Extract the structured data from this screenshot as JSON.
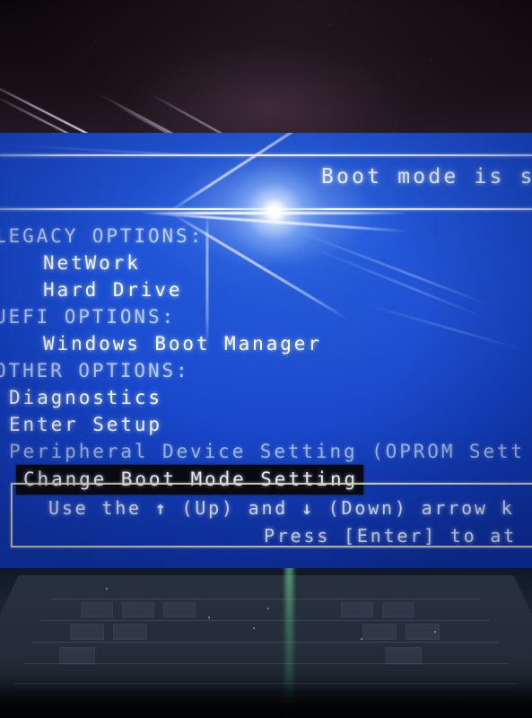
{
  "photo": {
    "subject": "bios-boot-menu-photo",
    "colors": {
      "screen_blue": "#1546cf",
      "text_white": "#ffffff",
      "text_dim": "#a9bfe6",
      "selection_background": "#0a0a10",
      "frame_border": "#eeebce",
      "keyboard_dark": "#18212f",
      "flare_white": "#ffffff",
      "green_beam": "#82ffa0"
    }
  },
  "bios": {
    "header": {
      "text": "Boot mode is s"
    },
    "menu": [
      {
        "label": "LEGACY OPTIONS:",
        "kind": "group",
        "selected": false
      },
      {
        "label": "NetWork",
        "kind": "item",
        "selected": false,
        "indent": true
      },
      {
        "label": "Hard Drive",
        "kind": "item",
        "selected": false,
        "indent": true
      },
      {
        "label": "UEFI OPTIONS:",
        "kind": "group",
        "selected": false
      },
      {
        "label": "Windows Boot Manager",
        "kind": "item",
        "selected": false,
        "indent": true
      },
      {
        "label": "OTHER OPTIONS:",
        "kind": "group",
        "selected": false
      },
      {
        "label": "Diagnostics",
        "kind": "item",
        "selected": false,
        "indent": false
      },
      {
        "label": "Enter Setup",
        "kind": "item",
        "selected": false,
        "indent": false
      },
      {
        "label": "Peripheral Device Setting (OPROM Sett",
        "kind": "disabled",
        "selected": false
      },
      {
        "label": "Change Boot Mode Setting",
        "kind": "selected",
        "selected": true
      }
    ],
    "help": {
      "line1_prefix": "Use the ",
      "up_arrow": "↑",
      "line1_middle": " (Up) and ",
      "down_arrow": "↓",
      "line1_suffix": " (Down) arrow k",
      "line2": "Press [Enter] to at"
    }
  }
}
